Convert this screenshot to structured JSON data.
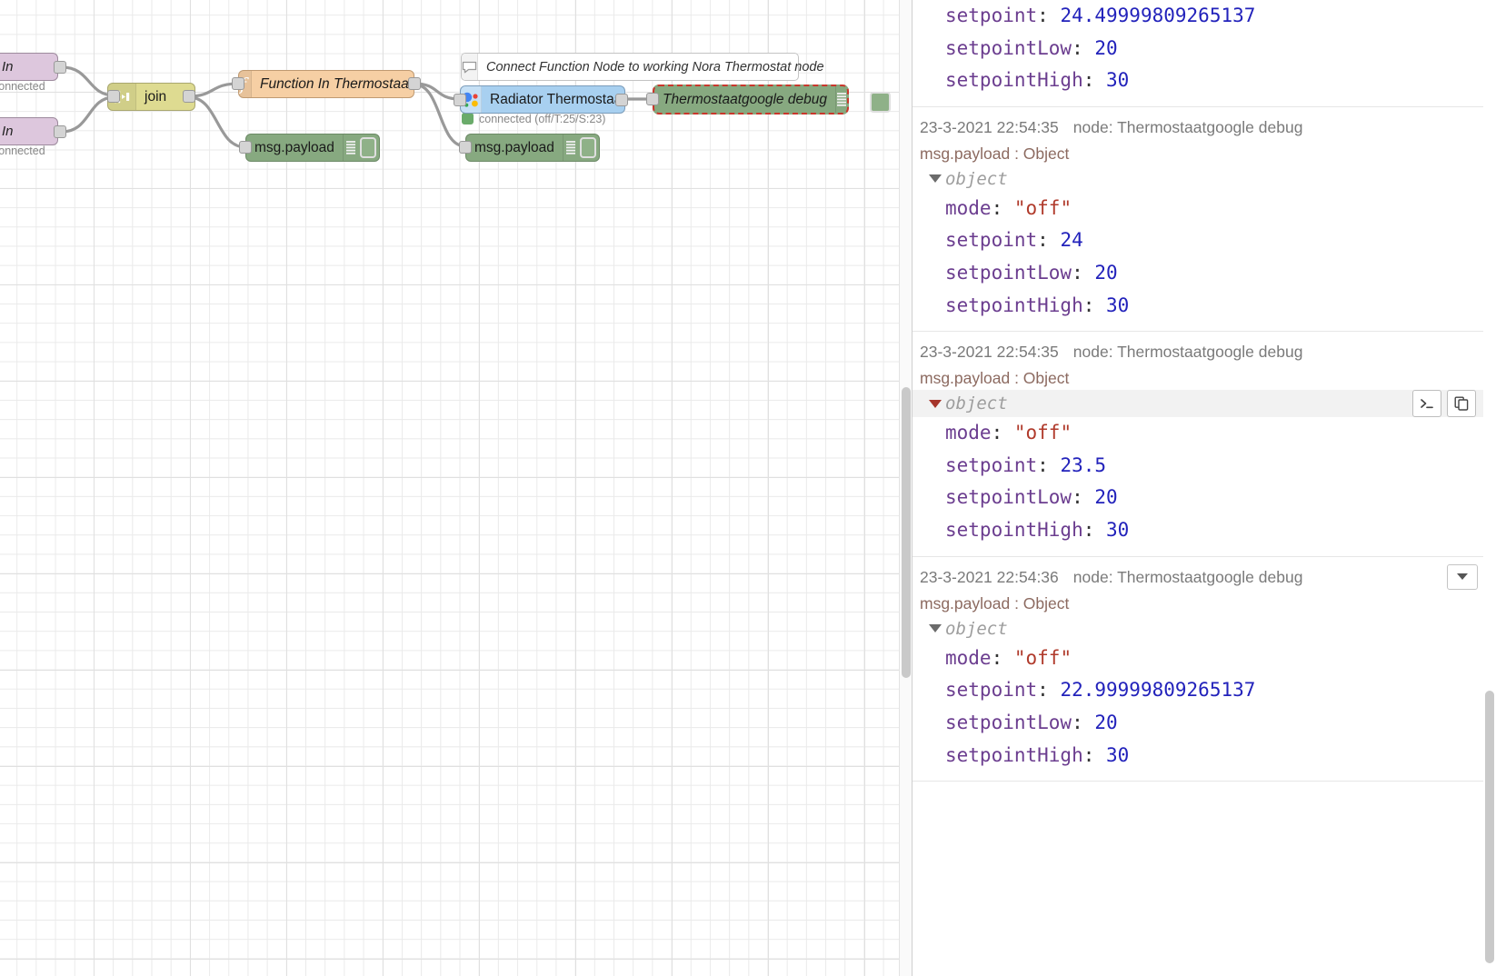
{
  "flow": {
    "nodes": [
      {
        "id": "in1",
        "type": "input-node",
        "label": "In",
        "status": "connected"
      },
      {
        "id": "in2",
        "type": "input-node",
        "label": "In",
        "status": "connected"
      },
      {
        "id": "join",
        "type": "join-node",
        "label": "join",
        "icon": "join-icon"
      },
      {
        "id": "func",
        "type": "function-node",
        "label": "Function In Thermostaat",
        "icon": "function-f-icon"
      },
      {
        "id": "dbg1",
        "type": "debug-node",
        "label": "msg.payload",
        "icon": "debug-lines-icon"
      },
      {
        "id": "dbg2",
        "type": "debug-node",
        "label": "msg.payload",
        "icon": "debug-lines-icon"
      },
      {
        "id": "nora",
        "type": "google-node",
        "label": "Radiator Thermostaat",
        "icon": "google-assistant-icon",
        "status": "connected (off/T:25/S:23)"
      },
      {
        "id": "dbg3",
        "type": "debug-node",
        "label": "Thermostaatgoogle debug",
        "icon": "debug-lines-icon",
        "selected": true
      }
    ],
    "comment": {
      "label": "Connect Function Node to working Nora Thermostat node",
      "icon": "comment-bubble-icon"
    }
  },
  "debug_panel": {
    "topic_label": "msg.payload : Object",
    "object_label": "object",
    "node_prefix": "node: ",
    "tools": {
      "terminal_label": ">_",
      "copy_label": "copy-icon",
      "menu_label": "chevron-down-icon"
    },
    "messages": [
      {
        "partial_top": true,
        "time": "",
        "node": "",
        "topic": "",
        "fields": [
          {
            "key": "setpoint",
            "value": "24.49999809265137",
            "vtype": "num"
          },
          {
            "key": "setpointLow",
            "value": "20",
            "vtype": "num"
          },
          {
            "key": "setpointHigh",
            "value": "30",
            "vtype": "num"
          }
        ]
      },
      {
        "time": "23-3-2021 22:54:35",
        "node": "node: Thermostaatgoogle debug",
        "topic": "msg.payload : Object",
        "object_label": "object",
        "highlighted": false,
        "fields": [
          {
            "key": "mode",
            "value": "\"off\"",
            "vtype": "str"
          },
          {
            "key": "setpoint",
            "value": "24",
            "vtype": "num"
          },
          {
            "key": "setpointLow",
            "value": "20",
            "vtype": "num"
          },
          {
            "key": "setpointHigh",
            "value": "30",
            "vtype": "num"
          }
        ]
      },
      {
        "time": "23-3-2021 22:54:35",
        "node": "node: Thermostaatgoogle debug",
        "topic": "msg.payload : Object",
        "object_label": "object",
        "highlighted": true,
        "fields": [
          {
            "key": "mode",
            "value": "\"off\"",
            "vtype": "str"
          },
          {
            "key": "setpoint",
            "value": "23.5",
            "vtype": "num"
          },
          {
            "key": "setpointLow",
            "value": "20",
            "vtype": "num"
          },
          {
            "key": "setpointHigh",
            "value": "30",
            "vtype": "num"
          }
        ]
      },
      {
        "time": "23-3-2021 22:54:36",
        "node": "node: Thermostaatgoogle debug",
        "topic": "msg.payload : Object",
        "object_label": "object",
        "highlighted": false,
        "has_menu": true,
        "fields": [
          {
            "key": "mode",
            "value": "\"off\"",
            "vtype": "str"
          },
          {
            "key": "setpoint",
            "value": "22.99999809265137",
            "vtype": "num"
          },
          {
            "key": "setpointLow",
            "value": "20",
            "vtype": "num"
          },
          {
            "key": "setpointHigh",
            "value": "30",
            "vtype": "num"
          }
        ]
      }
    ]
  },
  "colors": {
    "input_node": "#ddc7dd",
    "join_node": "#dedb91",
    "function_node": "#f6cfa4",
    "google_node": "#a8d0f0",
    "debug_node": "#87a980",
    "selection": "#c9372c",
    "key": "#6b3d8f",
    "number": "#2222bb",
    "string": "#b03a2b",
    "topic": "#8c6a60"
  }
}
